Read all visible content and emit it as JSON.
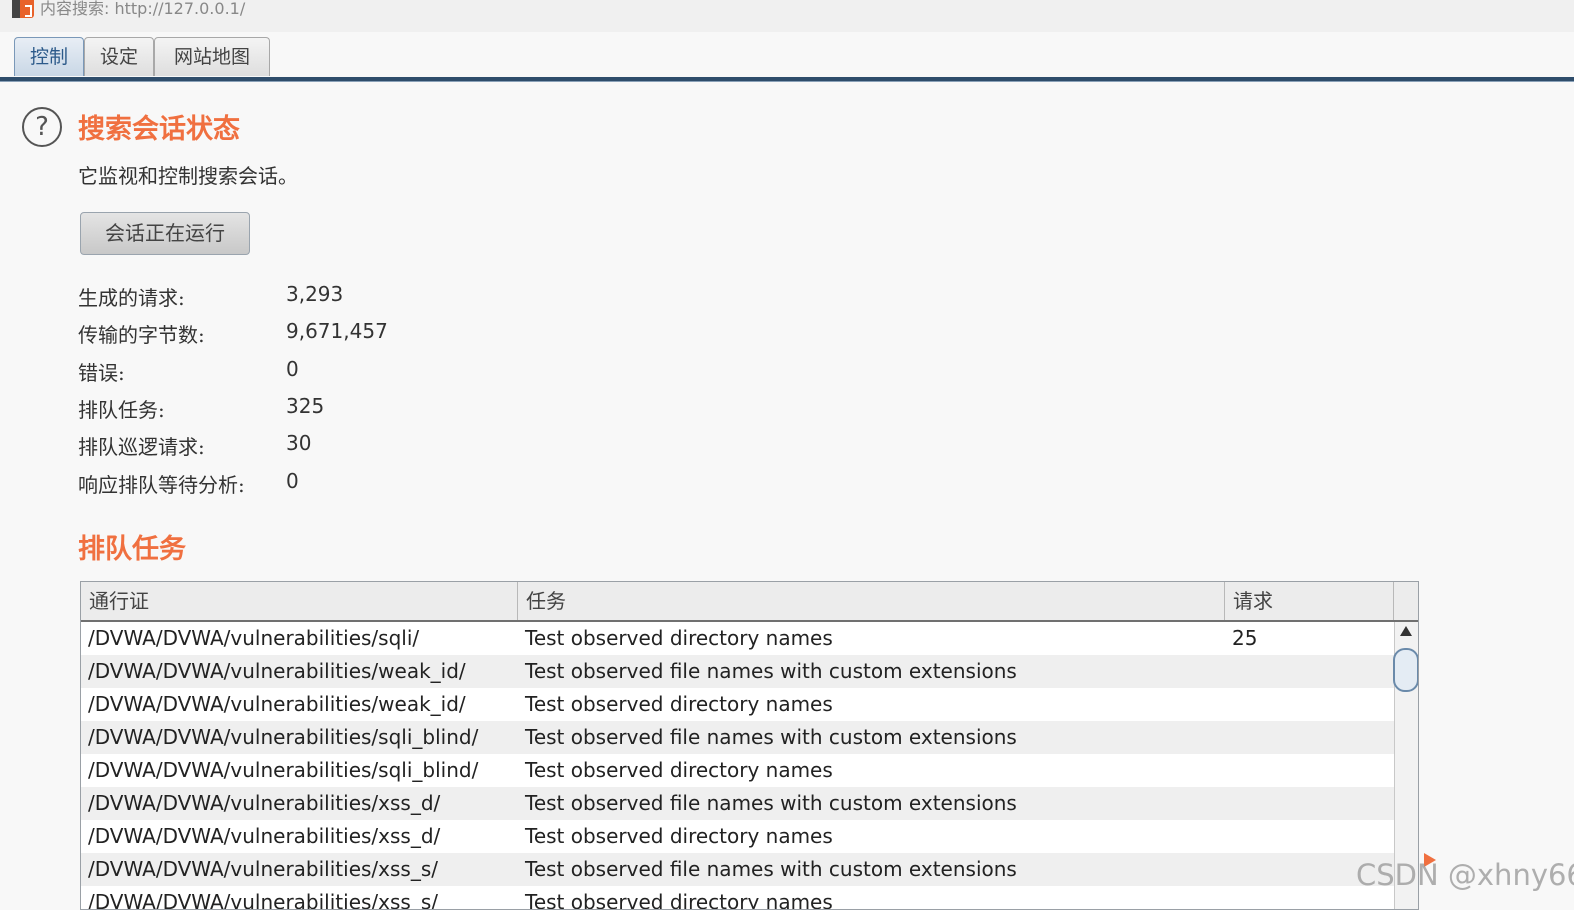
{
  "window": {
    "title": "内容搜索: http://127.0.0.1/"
  },
  "tabs": [
    {
      "label": "控制",
      "active": true
    },
    {
      "label": "设定",
      "active": false
    },
    {
      "label": "网站地图",
      "active": false
    }
  ],
  "status": {
    "help_glyph": "?",
    "title": "搜索会话状态",
    "description": "它监视和控制搜索会话。",
    "button_label": "会话正在运行",
    "stats": [
      {
        "label": "生成的请求:",
        "value": "3,293"
      },
      {
        "label": "传输的字节数:",
        "value": "9,671,457"
      },
      {
        "label": "错误:",
        "value": "0"
      },
      {
        "label": "排队任务:",
        "value": "325"
      },
      {
        "label": "排队巡逻请求:",
        "value": "30"
      },
      {
        "label": "响应排队等待分析:",
        "value": "0"
      }
    ]
  },
  "queue": {
    "title": "排队任务",
    "columns": [
      "通行证",
      "任务",
      "请求"
    ],
    "rows": [
      [
        "/DVWA/DVWA/vulnerabilities/sqli/",
        "Test observed directory names",
        "25"
      ],
      [
        "/DVWA/DVWA/vulnerabilities/weak_id/",
        "Test observed file names with custom extensions",
        ""
      ],
      [
        "/DVWA/DVWA/vulnerabilities/weak_id/",
        "Test observed directory names",
        ""
      ],
      [
        "/DVWA/DVWA/vulnerabilities/sqli_blind/",
        "Test observed file names with custom extensions",
        ""
      ],
      [
        "/DVWA/DVWA/vulnerabilities/sqli_blind/",
        "Test observed directory names",
        ""
      ],
      [
        "/DVWA/DVWA/vulnerabilities/xss_d/",
        "Test observed file names with custom extensions",
        ""
      ],
      [
        "/DVWA/DVWA/vulnerabilities/xss_d/",
        "Test observed directory names",
        ""
      ],
      [
        "/DVWA/DVWA/vulnerabilities/xss_s/",
        "Test observed file names with custom extensions",
        ""
      ],
      [
        "/DVWA/DVWA/vulnerabilities/xss_s/",
        "Test observed directory names",
        ""
      ]
    ]
  },
  "watermark": "CSDN @xhny66",
  "colors": {
    "accent": "#f07040",
    "tab_line": "#2f4d6b"
  }
}
